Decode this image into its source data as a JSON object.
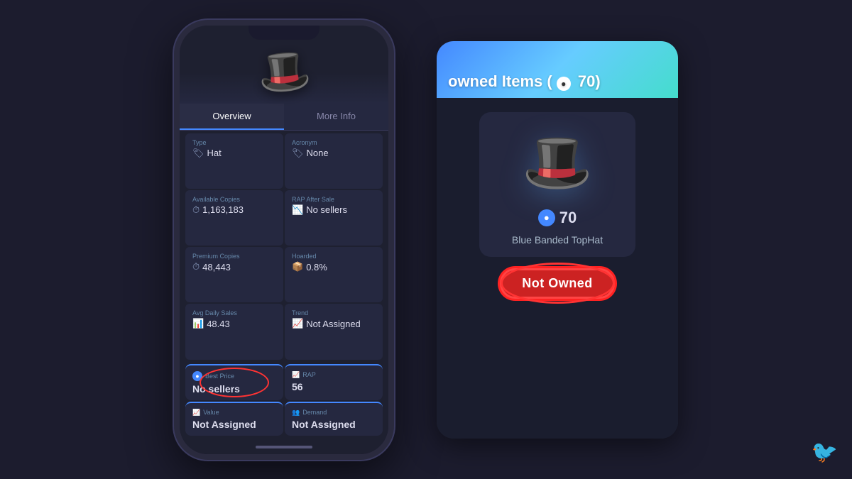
{
  "phone": {
    "hat_display": "🎩✨",
    "tabs": [
      {
        "label": "Overview",
        "active": true
      },
      {
        "label": "More Info",
        "active": false
      }
    ],
    "info_items": [
      {
        "icon": "🏷",
        "label": "Type",
        "value": "Hat"
      },
      {
        "icon": "🏷",
        "label": "Acronym",
        "value": "None"
      },
      {
        "icon": "⏱",
        "label": "Available Copies",
        "value": "1,163,183"
      },
      {
        "icon": "📉",
        "label": "RAP After Sale",
        "value": "No sellers"
      },
      {
        "icon": "⏱",
        "label": "Premium Copies",
        "value": "48,443"
      },
      {
        "icon": "📦",
        "label": "Hoarded",
        "value": "0.8%"
      },
      {
        "icon": "📊",
        "label": "Avg Daily Sales",
        "value": "48.43"
      },
      {
        "icon": "📈",
        "label": "Trend",
        "value": "Not Assigned"
      }
    ],
    "stats": [
      {
        "icon": "🔵",
        "label": "Best Price",
        "value": "No sellers",
        "highlight": true
      },
      {
        "icon": "📈",
        "label": "RAP",
        "value": "56",
        "highlight": false
      },
      {
        "icon": "📈",
        "label": "Value",
        "value": "Not Assigned",
        "highlight": false
      },
      {
        "icon": "👥",
        "label": "Demand",
        "value": "Not Assigned",
        "highlight": false
      }
    ]
  },
  "panel": {
    "header_title": "owned Items (●70)",
    "robux_price": "70",
    "item_name": "Blue Banded TopHat",
    "not_owned_label": "Not Owned"
  },
  "colors": {
    "accent": "#4488ff",
    "highlight_red": "#ff3333",
    "bg_dark": "#1e2030",
    "bg_mid": "#252840"
  }
}
